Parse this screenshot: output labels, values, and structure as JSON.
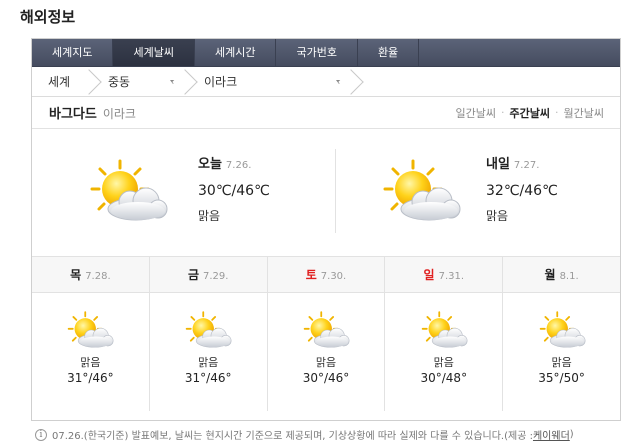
{
  "page_title": "해외정보",
  "tabs": [
    {
      "label": "세계지도",
      "active": false
    },
    {
      "label": "세계날씨",
      "active": true
    },
    {
      "label": "세계시간",
      "active": false
    },
    {
      "label": "국가번호",
      "active": false
    },
    {
      "label": "환율",
      "active": false
    }
  ],
  "breadcrumb": {
    "world": "세계",
    "region": "중동",
    "country": "이라크"
  },
  "location": {
    "city": "바그다드",
    "country": "이라크"
  },
  "period_tabs": [
    {
      "label": "일간날씨",
      "selected": false
    },
    {
      "label": "주간날씨",
      "selected": true
    },
    {
      "label": "월간날씨",
      "selected": false
    }
  ],
  "today": [
    {
      "day": "오늘",
      "date": "7.26.",
      "temp": "30℃/46℃",
      "condition": "맑음",
      "icon": "sunny-cloud-icon"
    },
    {
      "day": "내일",
      "date": "7.27.",
      "temp": "32℃/46℃",
      "condition": "맑음",
      "icon": "sunny-cloud-icon"
    }
  ],
  "week": [
    {
      "day": "목",
      "date": "7.28.",
      "condition": "맑음",
      "temp": "31°/46°",
      "weekend": false,
      "icon": "sunny-cloud-icon"
    },
    {
      "day": "금",
      "date": "7.29.",
      "condition": "맑음",
      "temp": "31°/46°",
      "weekend": false,
      "icon": "sunny-cloud-icon"
    },
    {
      "day": "토",
      "date": "7.30.",
      "condition": "맑음",
      "temp": "30°/46°",
      "weekend": true,
      "icon": "sunny-cloud-icon"
    },
    {
      "day": "일",
      "date": "7.31.",
      "condition": "맑음",
      "temp": "30°/48°",
      "weekend": true,
      "icon": "sunny-cloud-icon"
    },
    {
      "day": "월",
      "date": "8.1.",
      "condition": "맑음",
      "temp": "35°/50°",
      "weekend": false,
      "icon": "sunny-cloud-icon"
    }
  ],
  "notice": {
    "info_icon": "i",
    "text": "07.26.(한국기준) 발표예보, 날씨는 현지시간 기준으로 제공되며, 기상상황에 따라 실제와 다를 수 있습니다.(제공 : ",
    "provider": "케이웨더",
    "suffix": ")"
  },
  "colors": {
    "tab_bar": "#4f5668",
    "tab_active": "#2f3443",
    "weekend_red": "#e02020",
    "sun": "#f5c400",
    "cloud": "#e6e8ec"
  }
}
